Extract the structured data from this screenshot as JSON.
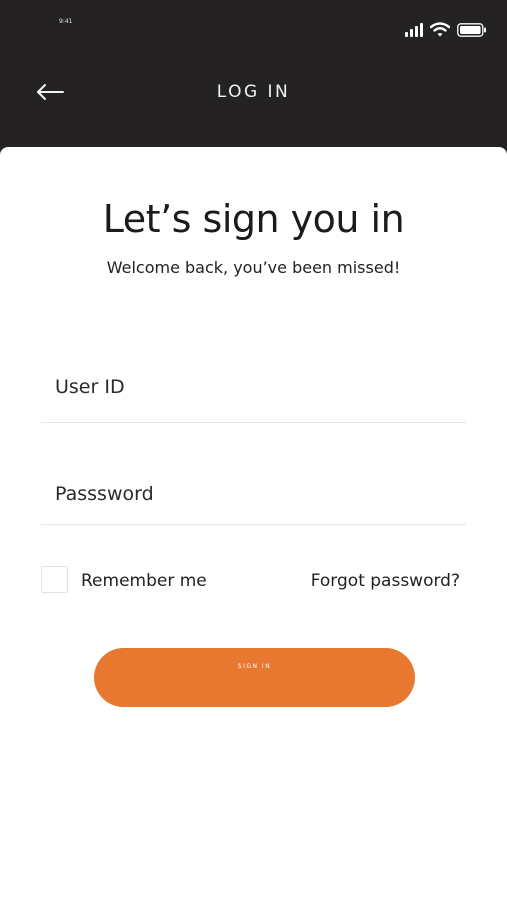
{
  "status_bar": {
    "time": "9:41",
    "icons": [
      "signal-icon",
      "wifi-icon",
      "battery-icon"
    ]
  },
  "nav": {
    "back_icon": "arrow-left-icon",
    "title": "LOG IN"
  },
  "login": {
    "title": "Let’s sign you in",
    "subtitle": "Welcome back, you’ve been missed!",
    "user_id_placeholder": "User ID",
    "password_placeholder": "Passsword",
    "remember_label": "Remember me",
    "remember_checked": false,
    "forgot_label": "Forgot password?",
    "sign_in_label": "SIGN IN"
  },
  "colors": {
    "header_bg": "#252223",
    "card_bg": "#ffffff",
    "accent": "#e8782f",
    "text": "#222222"
  }
}
